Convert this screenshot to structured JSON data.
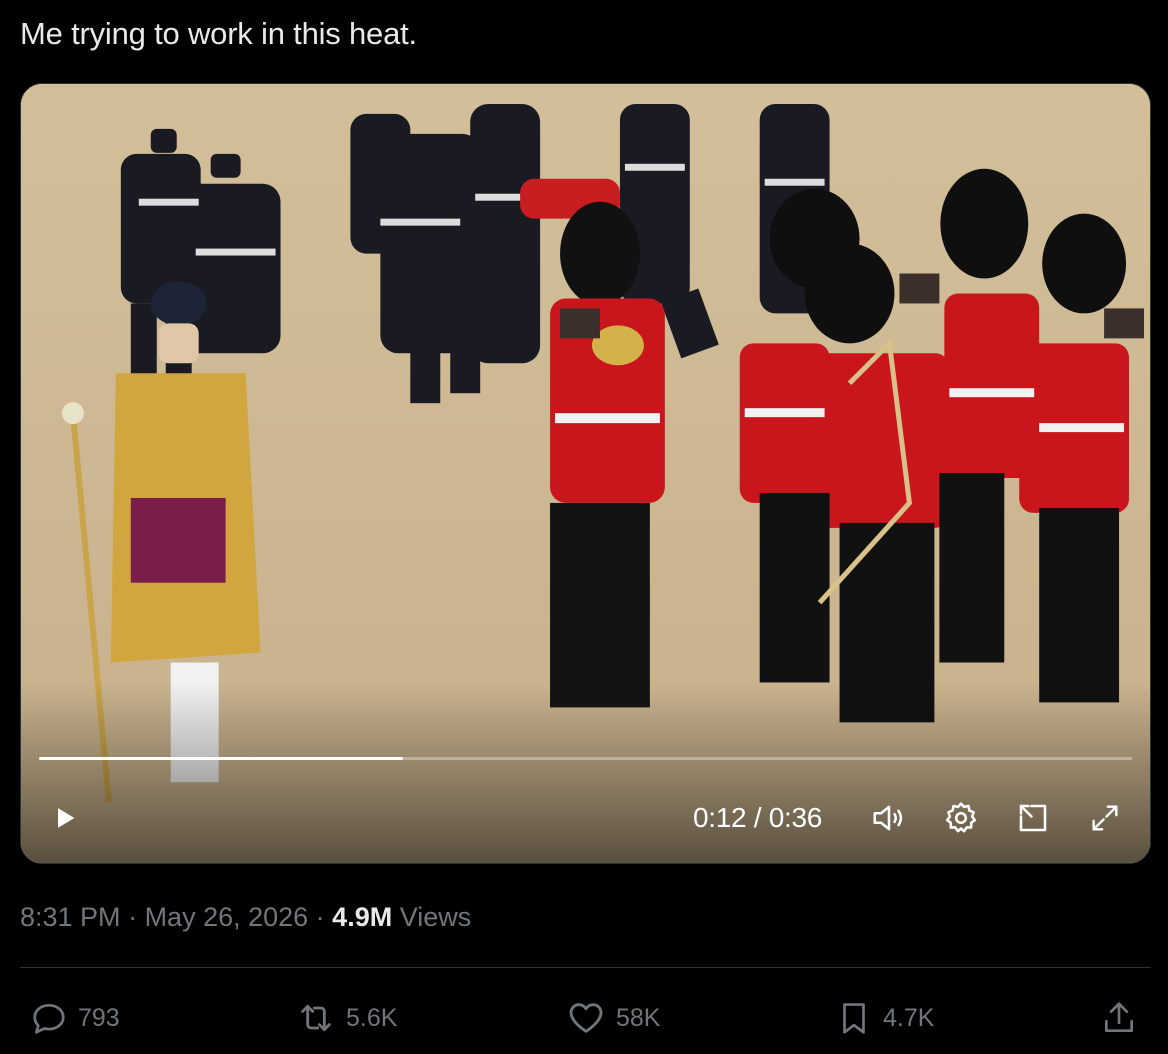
{
  "tweet": {
    "text": "Me trying to work in this heat."
  },
  "video": {
    "current_time": "0:12",
    "duration": "0:36",
    "time_display": "0:12 / 0:36",
    "progress": 0.333,
    "play_icon": "play-icon",
    "volume_icon": "volume-icon",
    "settings_icon": "gear-icon",
    "pip_icon": "picture-in-picture-icon",
    "fullscreen_icon": "expand-icon"
  },
  "meta": {
    "time": "8:31 PM",
    "separator": " · ",
    "date": "May 26, 2026",
    "views_count": "4.9M",
    "views_label": " Views"
  },
  "actions": {
    "replies": "793",
    "reposts": "5.6K",
    "likes": "58K",
    "bookmarks": "4.7K"
  },
  "colors": {
    "background": "#000000",
    "text": "#e7e9ea",
    "secondary": "#71767b",
    "divider": "#2f3336"
  }
}
